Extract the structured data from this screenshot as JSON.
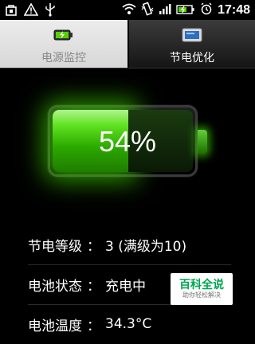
{
  "status_bar": {
    "time": "17:48",
    "icons": [
      "bag-icon",
      "warning-icon",
      "usb-icon",
      "wifi-icon",
      "vibrate-icon",
      "signal-icon",
      "battery-icon",
      "alarm-icon"
    ]
  },
  "tabs": [
    {
      "label": "电源监控",
      "active": true,
      "icon": "battery-charging-icon"
    },
    {
      "label": "节电优化",
      "active": false,
      "icon": "screen-icon"
    }
  ],
  "battery": {
    "percent_text": "54%",
    "level": 0.54
  },
  "info": {
    "save_level_label": "节电等级",
    "save_level_value": "3 (满级为10)",
    "battery_status_label": "电池状态",
    "battery_status_value": "充电中",
    "battery_temp_label": "电池温度",
    "battery_temp_value": "34.3°C"
  },
  "watermark": {
    "title": "百科全说",
    "subtitle": "助你轻松解决"
  }
}
